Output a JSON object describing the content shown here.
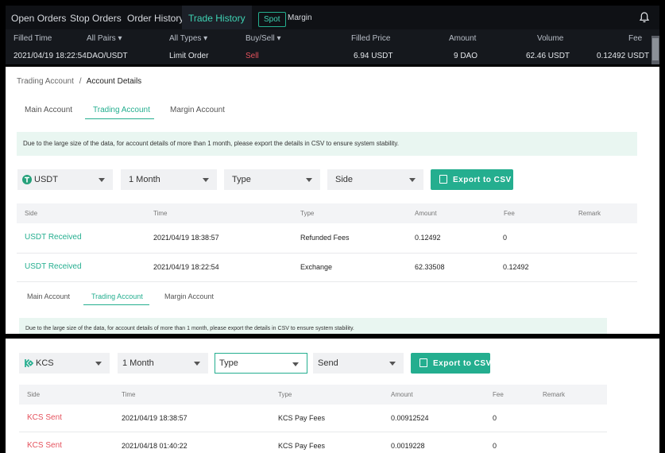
{
  "trade_panel": {
    "tabs": [
      "Open Orders",
      "Stop Orders",
      "Order History",
      "Trade History"
    ],
    "active_tab": "Trade History",
    "spot_label": "Spot",
    "margin_label": "Margin",
    "headers": {
      "filled_time": "Filled Time",
      "pairs": "All Pairs",
      "types": "All Types",
      "side": "Buy/Sell",
      "filled_price": "Filled Price",
      "amount": "Amount",
      "volume": "Volume",
      "fee": "Fee"
    },
    "row": {
      "time": "2021/04/19 18:22:54",
      "pair": "DAO/USDT",
      "type": "Limit Order",
      "side": "Sell",
      "price": "6.94 USDT",
      "amount": "9 DAO",
      "volume": "62.46 USDT",
      "fee": "0.12492 USDT"
    },
    "colors": {
      "accent": "#3fd3b4",
      "sell": "#e5525d"
    }
  },
  "account": {
    "breadcrumb_parent": "Trading Account",
    "breadcrumb_sep": "/",
    "breadcrumb_current": "Account Details",
    "tabs": [
      "Main Account",
      "Trading Account",
      "Margin Account"
    ],
    "active_tab": "Trading Account",
    "notice": "Due to the large size of the data, for account details of more than 1 month, please export the details in CSV to ensure system stability.",
    "filters": {
      "coin": "USDT",
      "period": "1 Month",
      "type": "Type",
      "side": "Side"
    },
    "export_label": "Export to CSV",
    "columns": [
      "Side",
      "Time",
      "Type",
      "Amount",
      "Fee",
      "Remark"
    ],
    "rows": [
      {
        "side": "USDT Received",
        "time": "2021/04/19 18:38:57",
        "type": "Refunded Fees",
        "amount": "0.12492",
        "fee": "0",
        "remark": ""
      },
      {
        "side": "USDT Received",
        "time": "2021/04/19 18:22:54",
        "type": "Exchange",
        "amount": "62.33508",
        "fee": "0.12492",
        "remark": ""
      }
    ],
    "tabs2": [
      "Main Account",
      "Trading Account",
      "Margin Account"
    ],
    "notice2": "Due to the large size of the data, for account details of more than 1 month, please export the details in CSV to ensure system stability.",
    "colors": {
      "accent": "#24ae8f",
      "received": "#24ae8f"
    }
  },
  "kcs_panel": {
    "filters": {
      "coin": "KCS",
      "period": "1 Month",
      "type": "Type",
      "side": "Send"
    },
    "export_label": "Export to CSV",
    "columns": [
      "Side",
      "Time",
      "Type",
      "Amount",
      "Fee",
      "Remark"
    ],
    "rows": [
      {
        "side": "KCS Sent",
        "time": "2021/04/19 18:38:57",
        "type": "KCS Pay Fees",
        "amount": "0.00912524",
        "fee": "0",
        "remark": ""
      },
      {
        "side": "KCS Sent",
        "time": "2021/04/18 01:40:22",
        "type": "KCS Pay Fees",
        "amount": "0.0019228",
        "fee": "0",
        "remark": ""
      }
    ],
    "colors": {
      "sent": "#e5525d"
    }
  }
}
